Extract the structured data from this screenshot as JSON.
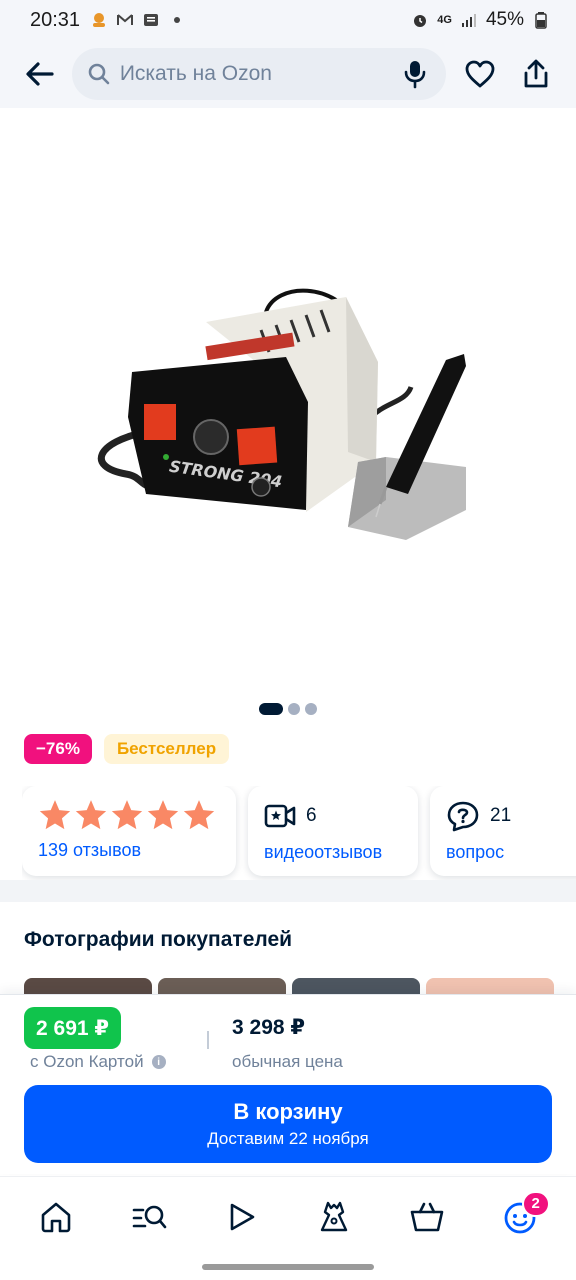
{
  "status_bar": {
    "time": "20:31",
    "network": "4G",
    "battery": "45%"
  },
  "top_bar": {
    "search_placeholder": "Искать на Ozon"
  },
  "gallery": {
    "total_images": 3,
    "active_index": 0
  },
  "badges": {
    "discount": "−76%",
    "bestseller": "Бестселлер"
  },
  "info_cards": {
    "reviews": {
      "rating_stars": 5,
      "link": "139 отзывов"
    },
    "video_reviews": {
      "count": "6",
      "link": "видеоотзывов"
    },
    "questions": {
      "count": "21",
      "link": "вопрос"
    }
  },
  "photos": {
    "title": "Фотографии покупателей",
    "thumb_colors": [
      "#5a4a44",
      "#6b5e56",
      "#4d5660",
      "#f0c2b0"
    ]
  },
  "price": {
    "card_price": "2 691 ₽",
    "card_price_label": "с Ozon Картой",
    "regular_price": "3 298 ₽",
    "regular_price_label": "обычная цена"
  },
  "cart_button": {
    "title": "В корзину",
    "subtitle": "Доставим 22 ноября"
  },
  "bottom_nav": {
    "items": [
      "home-icon",
      "search-catalog-icon",
      "video-play-icon",
      "fresh-dress-icon",
      "cart-icon",
      "profile-icon"
    ],
    "profile_badge": "2"
  },
  "colors": {
    "accent_blue": "#005bff",
    "discount_pink": "#f1117e",
    "price_green": "#10c44c",
    "star_orange": "#f98865"
  }
}
